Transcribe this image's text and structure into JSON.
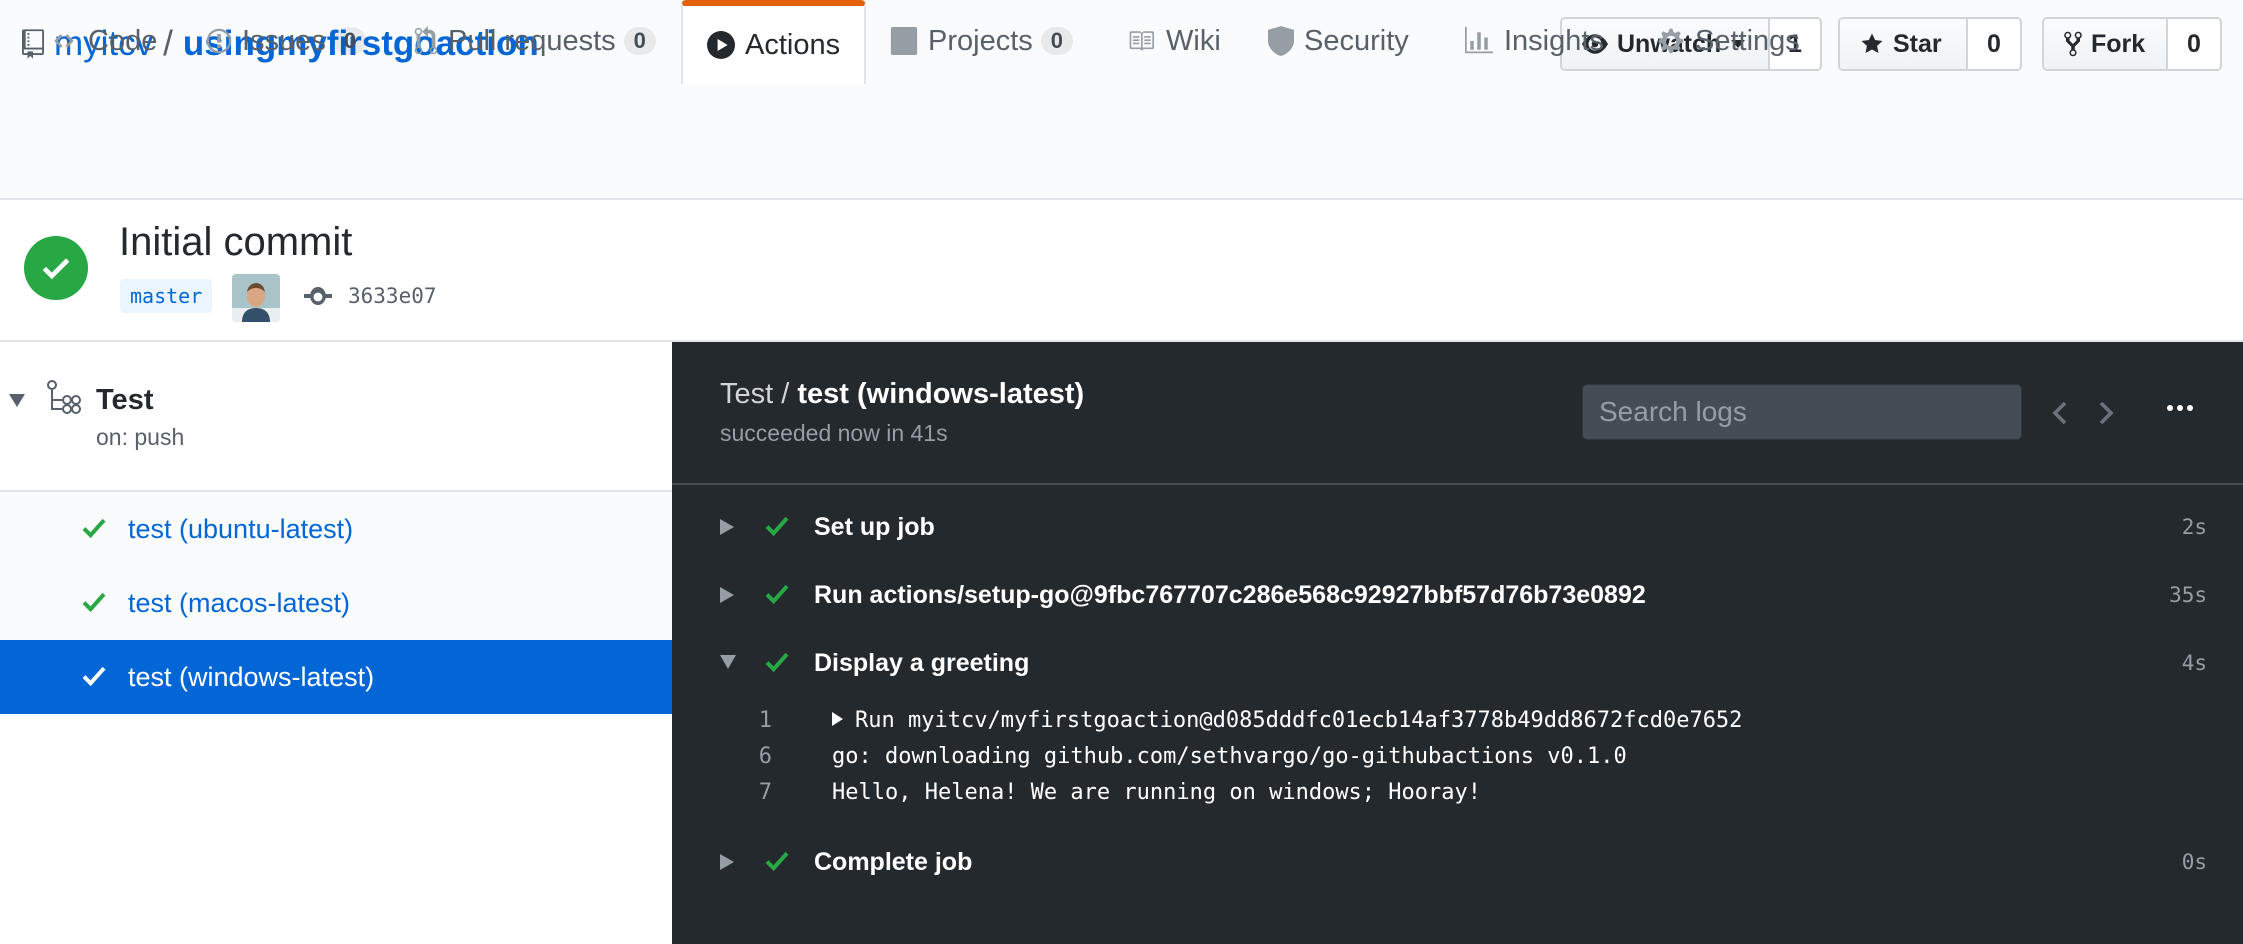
{
  "repo": {
    "owner": "myitcv",
    "separator": "/",
    "name": "usingmyfirstgoaction"
  },
  "actions": {
    "watch": {
      "label": "Unwatch",
      "count": "1"
    },
    "star": {
      "label": "Star",
      "count": "0"
    },
    "fork": {
      "label": "Fork",
      "count": "0"
    }
  },
  "tabs": [
    {
      "label": "Code",
      "icon": "code-icon"
    },
    {
      "label": "Issues",
      "count": "0",
      "icon": "issue-icon"
    },
    {
      "label": "Pull requests",
      "count": "0",
      "icon": "pull-request-icon"
    },
    {
      "label": "Actions",
      "icon": "play-icon",
      "selected": true
    },
    {
      "label": "Projects",
      "count": "0",
      "icon": "project-icon"
    },
    {
      "label": "Wiki",
      "icon": "book-icon"
    },
    {
      "label": "Security",
      "icon": "shield-icon"
    },
    {
      "label": "Insights",
      "icon": "graph-icon"
    },
    {
      "label": "Settings",
      "icon": "gear-icon"
    }
  ],
  "commit": {
    "title": "Initial commit",
    "branch": "master",
    "sha": "3633e07"
  },
  "workflow": {
    "name": "Test",
    "trigger": "on: push",
    "jobs": [
      {
        "label": "test (ubuntu-latest)"
      },
      {
        "label": "test (macos-latest)"
      },
      {
        "label": "test (windows-latest)",
        "active": true
      }
    ]
  },
  "log": {
    "title_prefix": "Test /",
    "title_job": "test (windows-latest)",
    "subtitle": "succeeded now in 41s",
    "search_placeholder": "Search logs",
    "steps": [
      {
        "name": "Set up job",
        "duration": "2s",
        "expanded": false
      },
      {
        "name": "Run actions/setup-go@9fbc767707c286e568c92927bbf57d76b73e0892",
        "duration": "35s",
        "expanded": false
      },
      {
        "name": "Display a greeting",
        "duration": "4s",
        "expanded": true
      },
      {
        "name": "Complete job",
        "duration": "0s",
        "expanded": false
      }
    ],
    "lines": [
      {
        "num": "1",
        "text": "Run myitcv/myfirstgoaction@d085dddfc01ecb14af3778b49dd8672fcd0e7652",
        "collapsed_group": true
      },
      {
        "num": "6",
        "text": "go: downloading github.com/sethvargo/go-githubactions v0.1.0"
      },
      {
        "num": "7",
        "text": "Hello, Helena! We are running on windows; Hooray!"
      }
    ]
  },
  "colors": {
    "success": "#28a745",
    "link": "#0366d6",
    "tab_accent": "#e36209",
    "log_bg": "#24292e"
  }
}
